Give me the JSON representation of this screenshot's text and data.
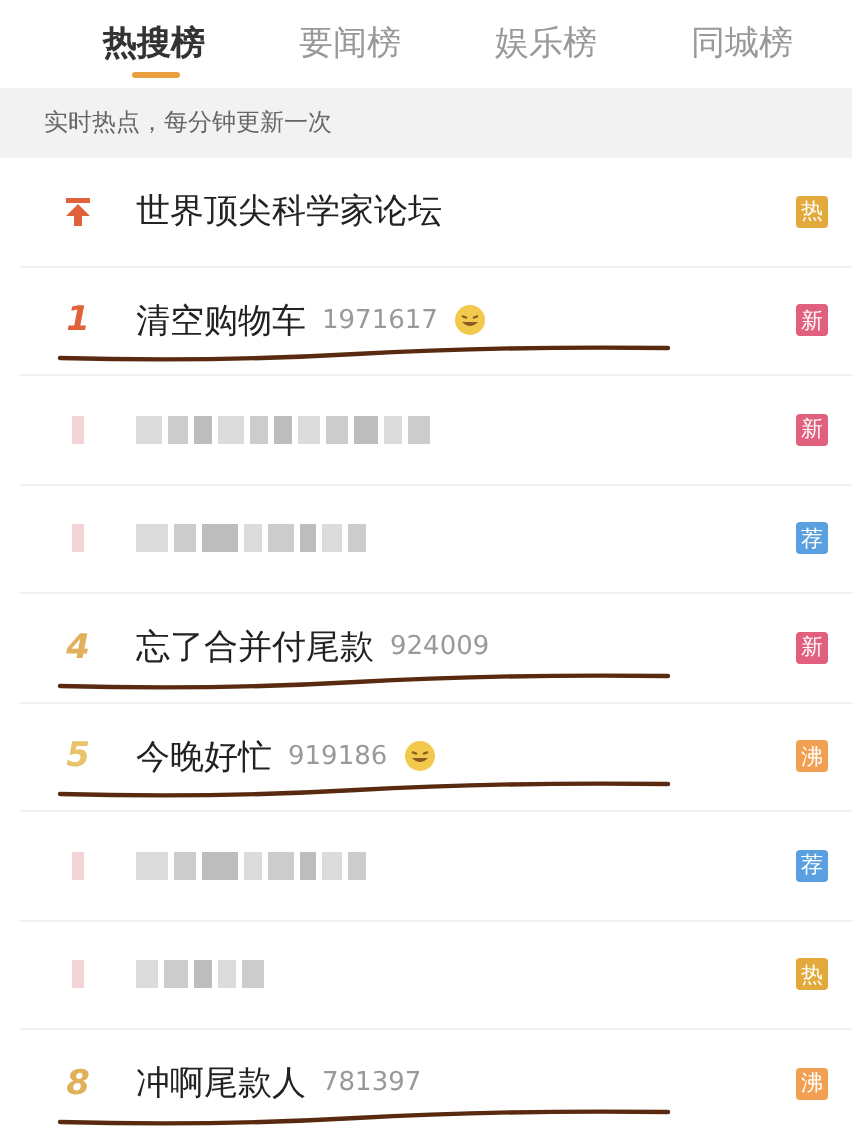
{
  "tabs": [
    {
      "label": "热搜榜",
      "selected": true
    },
    {
      "label": "要闻榜",
      "selected": false
    },
    {
      "label": "娱乐榜",
      "selected": false
    },
    {
      "label": "同城榜",
      "selected": false
    }
  ],
  "notice": "实时热点，每分钟更新一次",
  "rows": [
    {
      "kind": "pinned",
      "title": "世界顶尖科学家论坛",
      "badge": {
        "text": "热",
        "color": "#e2a93b"
      }
    },
    {
      "kind": "ranked",
      "rank": "1",
      "color": "#e0623a",
      "title": "清空购物车",
      "count": "1971617",
      "emoji": true,
      "underlined": true,
      "badge": {
        "text": "新",
        "color": "#e0607e"
      }
    },
    {
      "kind": "blurred",
      "badge": {
        "text": "新",
        "color": "#e0607e"
      }
    },
    {
      "kind": "blurred",
      "badge": {
        "text": "荐",
        "color": "#5aa0e0"
      }
    },
    {
      "kind": "ranked",
      "rank": "4",
      "color": "#e2b05a",
      "title": "忘了合并付尾款",
      "count": "924009",
      "emoji": false,
      "underlined": true,
      "badge": {
        "text": "新",
        "color": "#e0607e"
      }
    },
    {
      "kind": "ranked",
      "rank": "5",
      "color": "#e8c36a",
      "title": "今晚好忙",
      "count": "919186",
      "emoji": true,
      "underlined": true,
      "badge": {
        "text": "沸",
        "color": "#f0a050"
      }
    },
    {
      "kind": "blurred",
      "badge": {
        "text": "荐",
        "color": "#5aa0e0"
      }
    },
    {
      "kind": "blurred",
      "badge": {
        "text": "热",
        "color": "#e2a93b"
      }
    },
    {
      "kind": "ranked",
      "rank": "8",
      "color": "#e2b05a",
      "title": "冲啊尾款人",
      "count": "781397",
      "emoji": false,
      "underlined": true,
      "badge": {
        "text": "沸",
        "color": "#f0a050"
      }
    }
  ]
}
